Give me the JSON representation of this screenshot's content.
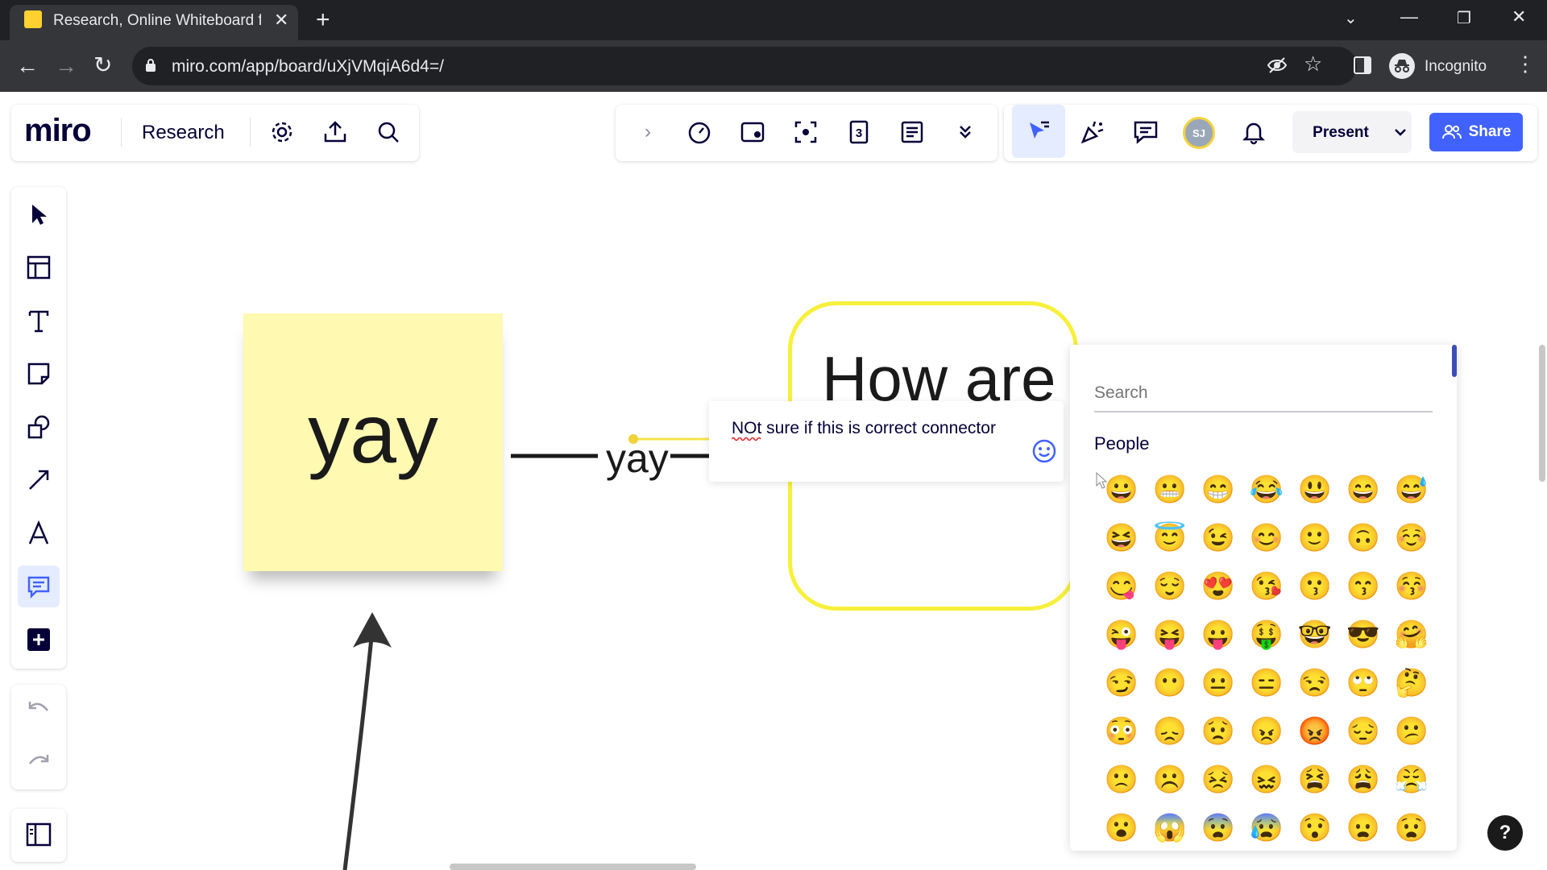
{
  "browser": {
    "tab_title": "Research, Online Whiteboard for",
    "url": "miro.com/app/board/uXjVMqiA6d4=/",
    "incognito_label": "Incognito"
  },
  "miro": {
    "logo": "miro",
    "board_name": "Research",
    "present_label": "Present",
    "share_label": "Share",
    "avatar_initials": "SJ"
  },
  "canvas": {
    "sticky_text": "yay",
    "connector_label": "yay",
    "shape_text": "How are",
    "comment_text": "NOt sure if this is correct connector"
  },
  "emoji_picker": {
    "search_placeholder": "Search",
    "category": "People",
    "emojis": [
      "😀",
      "😬",
      "😁",
      "😂",
      "😃",
      "😄",
      "😅",
      "😆",
      "😇",
      "😉",
      "😊",
      "🙂",
      "🙃",
      "☺️",
      "😋",
      "😌",
      "😍",
      "😘",
      "😗",
      "😙",
      "😚",
      "😜",
      "😝",
      "😛",
      "🤑",
      "🤓",
      "😎",
      "🤗",
      "😏",
      "😶",
      "😐",
      "😑",
      "😒",
      "🙄",
      "🤔",
      "😳",
      "😞",
      "😟",
      "😠",
      "😡",
      "😔",
      "😕",
      "🙁",
      "☹️",
      "😣",
      "😖",
      "😫",
      "😩",
      "😤",
      "😮",
      "😱",
      "😨",
      "😰",
      "😯",
      "😦",
      "😧"
    ]
  },
  "help_label": "?",
  "colors": {
    "share_blue": "#4262ff",
    "sticky_yellow": "#fff9b1",
    "shape_border": "#f7f03a",
    "chrome_dark": "#202124"
  }
}
